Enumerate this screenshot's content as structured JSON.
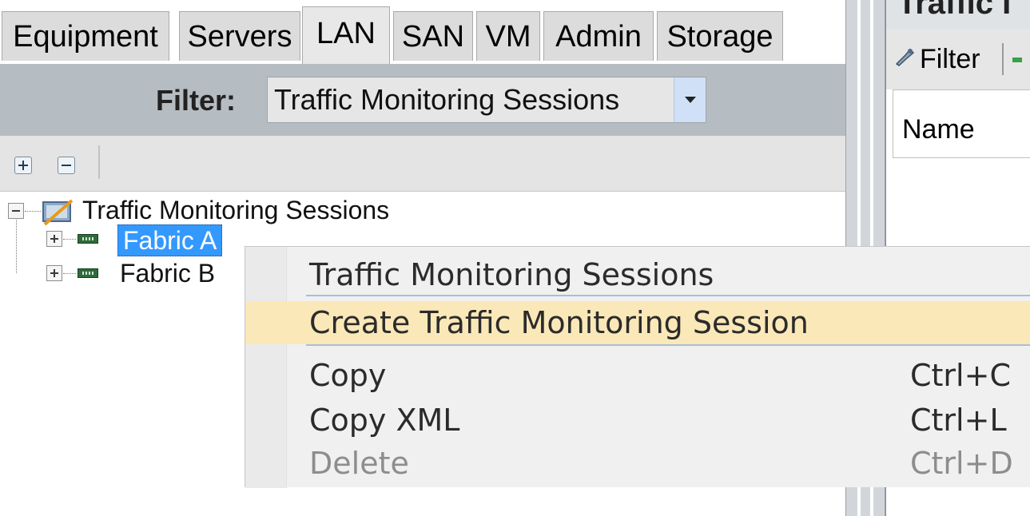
{
  "tabs": [
    {
      "label": "Equipment",
      "active": false
    },
    {
      "label": "Servers",
      "active": false
    },
    {
      "label": "LAN",
      "active": true
    },
    {
      "label": "SAN",
      "active": false
    },
    {
      "label": "VM",
      "active": false
    },
    {
      "label": "Admin",
      "active": false
    },
    {
      "label": "Storage",
      "active": false
    }
  ],
  "filter": {
    "label": "Filter:",
    "value": "Traffic Monitoring Sessions"
  },
  "tree": {
    "root": {
      "label": "Traffic Monitoring Sessions",
      "expanded": true
    },
    "children": [
      {
        "label": "Fabric A",
        "selected": true,
        "expanded": false
      },
      {
        "label": "Fabric B",
        "selected": false,
        "expanded": false
      }
    ]
  },
  "right_pane": {
    "title": "Traffic I",
    "toolbar_filter_label": "Filter",
    "column_header": "Name"
  },
  "context_menu": {
    "items": [
      {
        "label": "Traffic Monitoring Sessions",
        "shortcut": "",
        "highlighted": false,
        "disabled": false
      },
      {
        "label": "Create Traffic Monitoring Session",
        "shortcut": "",
        "highlighted": true,
        "disabled": false
      },
      {
        "label": "Copy",
        "shortcut": "Ctrl+C",
        "highlighted": false,
        "disabled": false
      },
      {
        "label": "Copy XML",
        "shortcut": "Ctrl+L",
        "highlighted": false,
        "disabled": false
      },
      {
        "label": "Delete",
        "shortcut": "Ctrl+D",
        "highlighted": false,
        "disabled": true
      }
    ]
  },
  "colors": {
    "selection": "#3399ff",
    "menu_highlight": "#fbe8b8",
    "filter_bar": "#b5bcc2"
  }
}
